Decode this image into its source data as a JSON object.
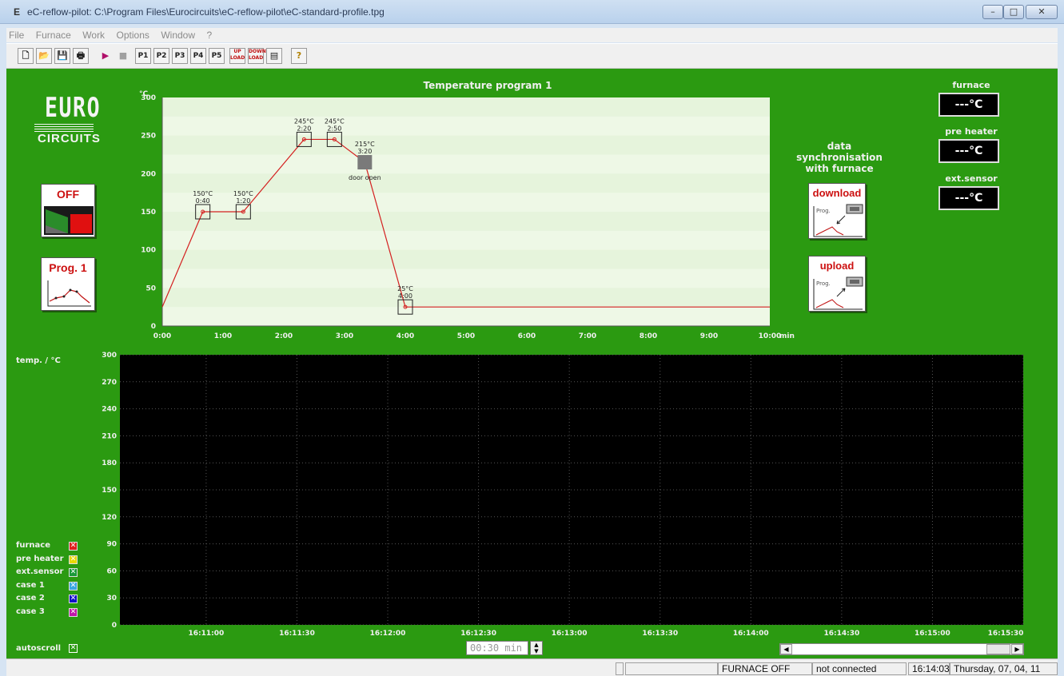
{
  "window": {
    "title": "eC-reflow-pilot:  C:\\Program Files\\Eurocircuits\\eC-reflow-pilot\\eC-standard-profile.tpg",
    "app_icon": "E",
    "buttons": [
      "minimize",
      "maximize",
      "close"
    ]
  },
  "menu": [
    "File",
    "Furnace",
    "Work",
    "Options",
    "Window",
    "?"
  ],
  "toolbar": {
    "items": [
      {
        "name": "new-icon",
        "glyph": "🗋"
      },
      {
        "name": "open-icon",
        "glyph": "📂"
      },
      {
        "name": "save-icon",
        "glyph": "💾"
      },
      {
        "name": "print-icon",
        "glyph": "🖶"
      },
      {
        "name": "play-icon",
        "glyph": "▶"
      },
      {
        "name": "stop-icon",
        "glyph": "■"
      },
      {
        "name": "program-1-icon",
        "glyph": "P1"
      },
      {
        "name": "program-2-icon",
        "glyph": "P2"
      },
      {
        "name": "program-3-icon",
        "glyph": "P3"
      },
      {
        "name": "program-4-icon",
        "glyph": "P4"
      },
      {
        "name": "program-5-icon",
        "glyph": "P5"
      },
      {
        "name": "upload-icon",
        "glyph": "UP LOAD"
      },
      {
        "name": "download-icon",
        "glyph": "DOWN LOAD"
      },
      {
        "name": "furnace-icon",
        "glyph": "▤"
      },
      {
        "name": "help-icon",
        "glyph": "?"
      }
    ]
  },
  "logo": {
    "line1": "EURO",
    "line2": "CIRCUITS"
  },
  "power_button": {
    "label": "OFF"
  },
  "program_button": {
    "label": "Prog. 1"
  },
  "sync": {
    "title_line1": "data",
    "title_line2": "synchronisation",
    "title_line3": "with furnace",
    "download_label": "download",
    "upload_label": "upload",
    "icon_text": "Prog."
  },
  "sensors": [
    {
      "label": "furnace",
      "value": "---°C"
    },
    {
      "label": "pre heater",
      "value": "---°C"
    },
    {
      "label": "ext.sensor",
      "value": "---°C"
    }
  ],
  "program_chart": {
    "title": "Temperature program 1",
    "y_unit": "°C",
    "x_unit": "min",
    "y_ticks": [
      "0",
      "50",
      "100",
      "150",
      "200",
      "250",
      "300"
    ],
    "x_ticks": [
      "0:00",
      "1:00",
      "2:00",
      "3:00",
      "4:00",
      "5:00",
      "6:00",
      "7:00",
      "8:00",
      "9:00",
      "10:00"
    ],
    "door_label": "door open"
  },
  "chart_data": {
    "type": "line",
    "title": "Temperature program 1",
    "xlabel": "min",
    "ylabel": "°C",
    "xlim_seconds": [
      0,
      600
    ],
    "ylim": [
      0,
      300
    ],
    "points": [
      {
        "t": 0,
        "temp": 25,
        "label": ""
      },
      {
        "t": 40,
        "temp": 150,
        "label_temp": "150°C",
        "label_time": "0:40"
      },
      {
        "t": 80,
        "temp": 150,
        "label_temp": "150°C",
        "label_time": "1:20"
      },
      {
        "t": 140,
        "temp": 245,
        "label_temp": "245°C",
        "label_time": "2:20"
      },
      {
        "t": 170,
        "temp": 245,
        "label_temp": "245°C",
        "label_time": "2:50"
      },
      {
        "t": 200,
        "temp": 215,
        "label_temp": "215°C",
        "label_time": "3:20",
        "marker": "door"
      },
      {
        "t": 240,
        "temp": 25,
        "label_temp": "25°C",
        "label_time": "4:00"
      },
      {
        "t": 600,
        "temp": 25,
        "label": ""
      }
    ],
    "line_color": "#d42020"
  },
  "live_plot": {
    "y_title": "temp. / °C",
    "y_ticks": [
      "0",
      "30",
      "60",
      "90",
      "120",
      "150",
      "180",
      "210",
      "240",
      "270",
      "300"
    ],
    "x_ticks": [
      "16:11:00",
      "16:11:30",
      "16:12:00",
      "16:12:30",
      "16:13:00",
      "16:13:30",
      "16:14:00",
      "16:14:30",
      "16:15:00",
      "16:15:30"
    ],
    "legend": [
      {
        "label": "furnace",
        "color": "#e0201e"
      },
      {
        "label": "pre heater",
        "color": "#e8d800"
      },
      {
        "label": "ext.sensor",
        "color": "#1a9a3a"
      },
      {
        "label": "case 1",
        "color": "#3aa7e0"
      },
      {
        "label": "case 2",
        "color": "#1010c8"
      },
      {
        "label": "case 3",
        "color": "#c018a8"
      }
    ],
    "autoscroll_label": "autoscroll",
    "interval": "00:30 min"
  },
  "status": {
    "furnace_state": "FURNACE OFF",
    "connection": "not connected",
    "time": "16:14:03",
    "date": "Thursday, 07, 04, 11"
  }
}
